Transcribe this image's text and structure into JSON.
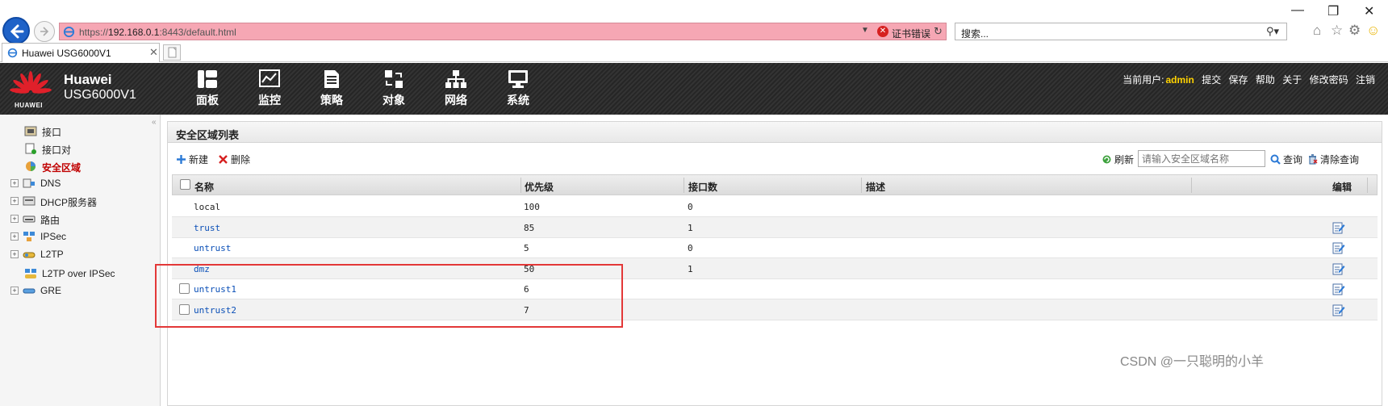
{
  "browser": {
    "url_prefix": "https://",
    "url_host": "192.168.0.1",
    "url_rest": ":8443/default.html",
    "cert_error": "证书错误",
    "search_placeholder": "搜索...",
    "tab_title": "Huawei USG6000V1"
  },
  "header": {
    "logo_text": "HUAWEI",
    "brand_name": "Huawei",
    "brand_model": "USG6000V1",
    "nav": [
      {
        "label": "面板",
        "icon": "dashboard-icon"
      },
      {
        "label": "监控",
        "icon": "monitor-icon"
      },
      {
        "label": "策略",
        "icon": "policy-icon"
      },
      {
        "label": "对象",
        "icon": "object-icon"
      },
      {
        "label": "网络",
        "icon": "network-icon"
      },
      {
        "label": "系统",
        "icon": "system-icon"
      }
    ],
    "current_user_label": "当前用户:",
    "current_user": "admin",
    "links": [
      "提交",
      "保存",
      "帮助",
      "关于",
      "修改密码",
      "注销"
    ]
  },
  "sidebar": {
    "items": [
      {
        "label": "接口",
        "expandable": false,
        "active": false
      },
      {
        "label": "接口对",
        "expandable": false,
        "active": false
      },
      {
        "label": "安全区域",
        "expandable": false,
        "active": true
      },
      {
        "label": "DNS",
        "expandable": true,
        "active": false
      },
      {
        "label": "DHCP服务器",
        "expandable": true,
        "active": false
      },
      {
        "label": "路由",
        "expandable": true,
        "active": false
      },
      {
        "label": "IPSec",
        "expandable": true,
        "active": false
      },
      {
        "label": "L2TP",
        "expandable": true,
        "active": false
      },
      {
        "label": "L2TP over IPSec",
        "expandable": false,
        "active": false
      },
      {
        "label": "GRE",
        "expandable": true,
        "active": false
      }
    ]
  },
  "panel": {
    "title": "安全区域列表",
    "toolbar": {
      "new_label": "新建",
      "delete_label": "删除",
      "refresh_label": "刷新",
      "search_placeholder": "请输入安全区域名称",
      "query_label": "查询",
      "clear_label": "清除查询"
    },
    "columns": [
      "名称",
      "优先级",
      "接口数",
      "描述",
      "编辑"
    ],
    "rows": [
      {
        "name": "local",
        "priority": "100",
        "interfaces": "0",
        "desc": "",
        "selectable": false,
        "editable": false
      },
      {
        "name": "trust",
        "priority": "85",
        "interfaces": "1",
        "desc": "",
        "selectable": false,
        "editable": true
      },
      {
        "name": "untrust",
        "priority": "5",
        "interfaces": "0",
        "desc": "",
        "selectable": false,
        "editable": true
      },
      {
        "name": "dmz",
        "priority": "50",
        "interfaces": "1",
        "desc": "",
        "selectable": false,
        "editable": true
      },
      {
        "name": "untrust1",
        "priority": "6",
        "interfaces": "",
        "desc": "",
        "selectable": true,
        "editable": true
      },
      {
        "name": "untrust2",
        "priority": "7",
        "interfaces": "",
        "desc": "",
        "selectable": true,
        "editable": true
      }
    ]
  },
  "watermark": "CSDN @一只聪明的小羊",
  "colors": {
    "address_bar_error": "#f6a7b4",
    "header_bg": "#2b2b2b",
    "active_nav": "#c00000",
    "link": "#0a4fb7",
    "user_highlight": "#ffd200",
    "annotation_box": "#e33838"
  }
}
